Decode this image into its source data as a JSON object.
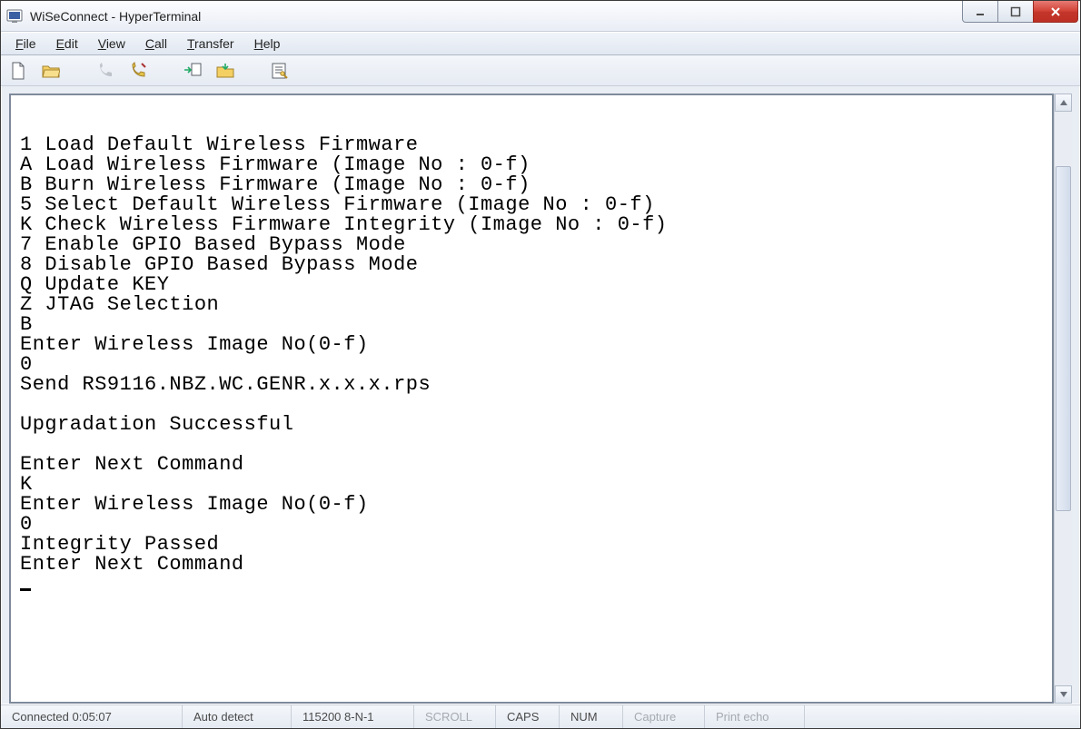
{
  "window": {
    "title": "WiSeConnect - HyperTerminal"
  },
  "menu": {
    "file": {
      "u": "F",
      "rest": "ile"
    },
    "edit": {
      "u": "E",
      "rest": "dit"
    },
    "view": {
      "u": "V",
      "rest": "iew"
    },
    "call": {
      "u": "C",
      "rest": "all"
    },
    "transfer": {
      "u": "T",
      "rest": "ransfer"
    },
    "help": {
      "u": "H",
      "rest": "elp"
    }
  },
  "toolbar": {
    "new": "new-file-icon",
    "open": "open-folder-icon",
    "connect": "phone-connect-icon",
    "disconnect": "phone-disconnect-icon",
    "send": "send-file-icon",
    "receive": "receive-file-icon",
    "properties": "properties-icon"
  },
  "terminal": {
    "lines": [
      "",
      "1 Load Default Wireless Firmware",
      "A Load Wireless Firmware (Image No : 0-f)",
      "B Burn Wireless Firmware (Image No : 0-f)",
      "5 Select Default Wireless Firmware (Image No : 0-f)",
      "K Check Wireless Firmware Integrity (Image No : 0-f)",
      "7 Enable GPIO Based Bypass Mode",
      "8 Disable GPIO Based Bypass Mode",
      "Q Update KEY",
      "Z JTAG Selection",
      "B",
      "Enter Wireless Image No(0-f)",
      "0",
      "Send RS9116.NBZ.WC.GENR.x.x.x.rps",
      "",
      "Upgradation Successful",
      "",
      "Enter Next Command",
      "K",
      "Enter Wireless Image No(0-f)",
      "0",
      "Integrity Passed",
      "Enter Next Command"
    ]
  },
  "status": {
    "connected": "Connected 0:05:07",
    "auto": "Auto detect",
    "port": "115200 8-N-1",
    "scroll": "SCROLL",
    "caps": "CAPS",
    "num": "NUM",
    "capture": "Capture",
    "echo": "Print echo"
  }
}
